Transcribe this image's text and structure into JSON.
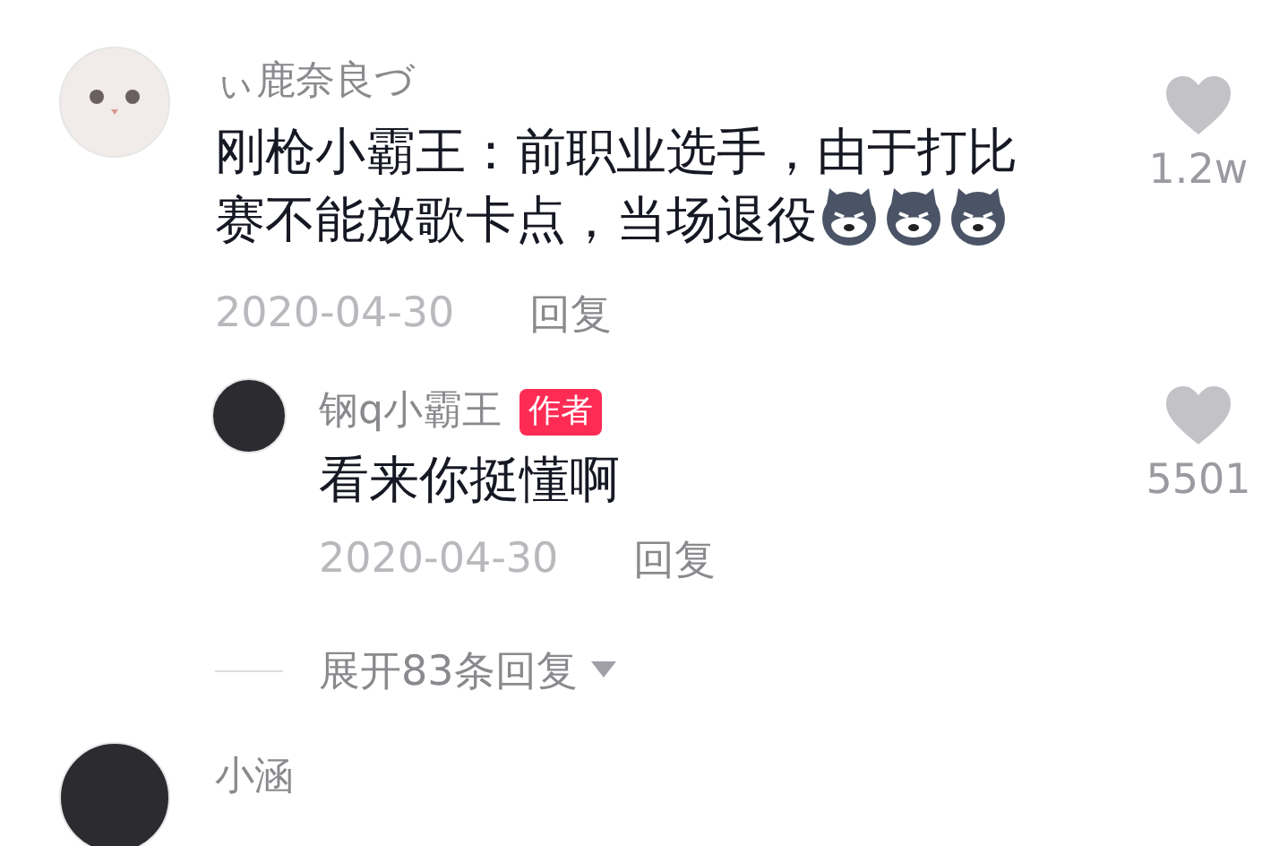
{
  "comments": [
    {
      "author": "ぃ鹿奈良づ",
      "avatar": {
        "kind": "cat"
      },
      "text": "刚枪小霸王：前职业选手，由于打比赛不能放歌卡点，当场退役",
      "emojis": [
        {
          "kind": "wolf"
        },
        {
          "kind": "wolf"
        },
        {
          "kind": "wolf"
        }
      ],
      "date": "2020-04-30",
      "reply_label": "回复",
      "likes": "1.2w",
      "replies": [
        {
          "author": "钢q小霸王",
          "avatar": {
            "kind": "photo"
          },
          "author_badge": "作者",
          "text": "看来你挺懂啊",
          "date": "2020-04-30",
          "reply_label": "回复",
          "likes": "5501"
        }
      ],
      "expand_label": "展开83条回复"
    },
    {
      "author": "小涵",
      "avatar": {
        "kind": "photo"
      }
    }
  ]
}
